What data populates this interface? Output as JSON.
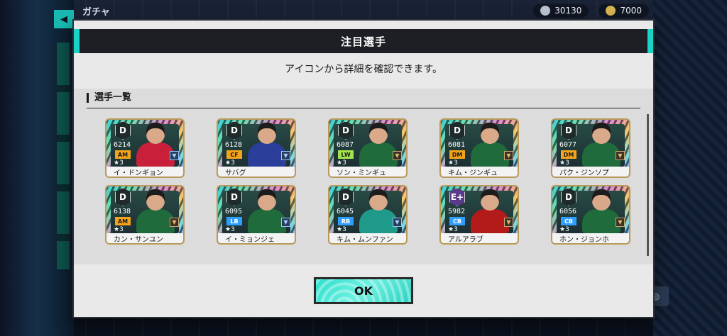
{
  "background": {
    "back_icon": "back-arrow-icon",
    "screen_title": "ガチャ",
    "coin1": "30130",
    "coin2": "7000",
    "right_icon": "circle-icon"
  },
  "modal": {
    "title": "注目選手",
    "subtitle": "アイコンから詳細を確認できます。",
    "section_title": "選手一覧",
    "ok_label": "OK",
    "players": [
      {
        "grade": "D",
        "ovr": "6214",
        "position": "AM",
        "pos_color": "orange",
        "stars": "★3",
        "name": "イ・ドンギョン",
        "kit": "#c8203a",
        "mini": "blue"
      },
      {
        "grade": "D",
        "ovr": "6128",
        "position": "CF",
        "pos_color": "orange",
        "stars": "★3",
        "name": "サバグ",
        "kit": "#2a3e9a",
        "mini": "blue"
      },
      {
        "grade": "D",
        "ovr": "6087",
        "position": "LW",
        "pos_color": "green",
        "stars": "★3",
        "name": "ソン・ミンギュ",
        "kit": "#1f6b3c",
        "mini": "gold"
      },
      {
        "grade": "D",
        "ovr": "6081",
        "position": "DM",
        "pos_color": "orange",
        "stars": "★3",
        "name": "キム・ジンギュ",
        "kit": "#1f6b3c",
        "mini": "gold"
      },
      {
        "grade": "D",
        "ovr": "6077",
        "position": "DM",
        "pos_color": "orange",
        "stars": "★3",
        "name": "パク・ジンソプ",
        "kit": "#1f6b3c",
        "mini": "gold"
      },
      {
        "grade": "D",
        "ovr": "6138",
        "position": "AM",
        "pos_color": "orange",
        "stars": "★3",
        "name": "カン・サンユン",
        "kit": "#1f6b3c",
        "mini": "gold"
      },
      {
        "grade": "D",
        "ovr": "6095",
        "position": "LB",
        "pos_color": "blue",
        "stars": "★3",
        "name": "イ・ミョンジェ",
        "kit": "#1f6b3c",
        "mini": "blue"
      },
      {
        "grade": "D",
        "ovr": "6045",
        "position": "RB",
        "pos_color": "blue",
        "stars": "★3",
        "name": "キム・ムンファン",
        "kit": "#1f9a8a",
        "mini": "blue"
      },
      {
        "grade": "E+",
        "ovr": "5982",
        "position": "CB",
        "pos_color": "blue",
        "stars": "★3",
        "name": "アルアラブ",
        "kit": "#b31b1b",
        "mini": "gold"
      },
      {
        "grade": "D",
        "ovr": "6056",
        "position": "CB",
        "pos_color": "blue",
        "stars": "★3",
        "name": "ホン・ジョンホ",
        "kit": "#1f6b3c",
        "mini": "gold"
      }
    ]
  }
}
